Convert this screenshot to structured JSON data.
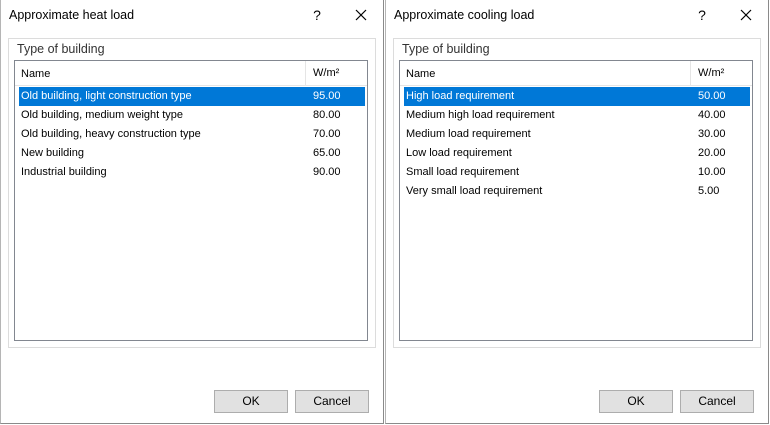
{
  "dialogs": [
    {
      "title": "Approximate heat load",
      "help": "?",
      "group_label": "Type of building",
      "columns": {
        "name": "Name",
        "value": "W/m²"
      },
      "rows": [
        {
          "name": "Old building, light construction type",
          "value": "95.00",
          "selected": true
        },
        {
          "name": "Old building, medium weight type",
          "value": "80.00",
          "selected": false
        },
        {
          "name": "Old building, heavy construction type",
          "value": "70.00",
          "selected": false
        },
        {
          "name": "New building",
          "value": "65.00",
          "selected": false
        },
        {
          "name": "Industrial building",
          "value": "90.00",
          "selected": false
        }
      ],
      "ok_label": "OK",
      "cancel_label": "Cancel"
    },
    {
      "title": "Approximate cooling load",
      "help": "?",
      "group_label": "Type of building",
      "columns": {
        "name": "Name",
        "value": "W/m²"
      },
      "rows": [
        {
          "name": "High load requirement",
          "value": "50.00",
          "selected": true
        },
        {
          "name": "Medium high load requirement",
          "value": "40.00",
          "selected": false
        },
        {
          "name": "Medium load requirement",
          "value": "30.00",
          "selected": false
        },
        {
          "name": "Low load requirement",
          "value": "20.00",
          "selected": false
        },
        {
          "name": "Small load requirement",
          "value": "10.00",
          "selected": false
        },
        {
          "name": "Very small load requirement",
          "value": "5.00",
          "selected": false
        }
      ],
      "ok_label": "OK",
      "cancel_label": "Cancel"
    }
  ],
  "icons": {
    "close": "close-icon",
    "help": "help-icon"
  },
  "colors": {
    "selection": "#0078d7",
    "selection_text": "#ffffff",
    "button_face": "#e1e1e1"
  }
}
